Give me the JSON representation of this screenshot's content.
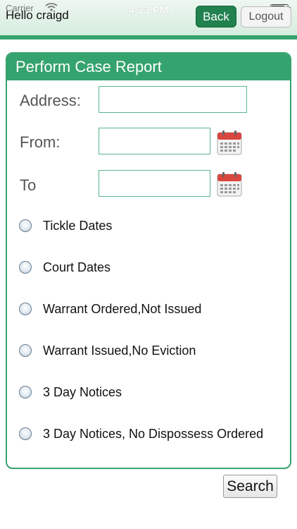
{
  "status_bar": {
    "carrier": "Carrier",
    "time": "4:33 PM"
  },
  "header": {
    "greeting": "Hello craigd",
    "back_label": "Back",
    "logout_label": "Logout"
  },
  "form": {
    "title": "Perform Case Report",
    "address_label": "Address:",
    "address_value": "",
    "from_label": "From:",
    "from_value": "",
    "to_label": "To",
    "to_value": "",
    "options": [
      "Tickle Dates",
      "Court Dates",
      "Warrant Ordered,Not Issued",
      "Warrant Issued,No Eviction",
      "3 Day Notices",
      "3 Day Notices, No Dispossess Ordered"
    ]
  },
  "search_label": "Search",
  "icons": {
    "calendar": "calendar-icon",
    "wifi": "wifi-icon",
    "battery": "battery-icon"
  },
  "colors": {
    "accent": "#35a36d",
    "back_button": "#21814f"
  }
}
